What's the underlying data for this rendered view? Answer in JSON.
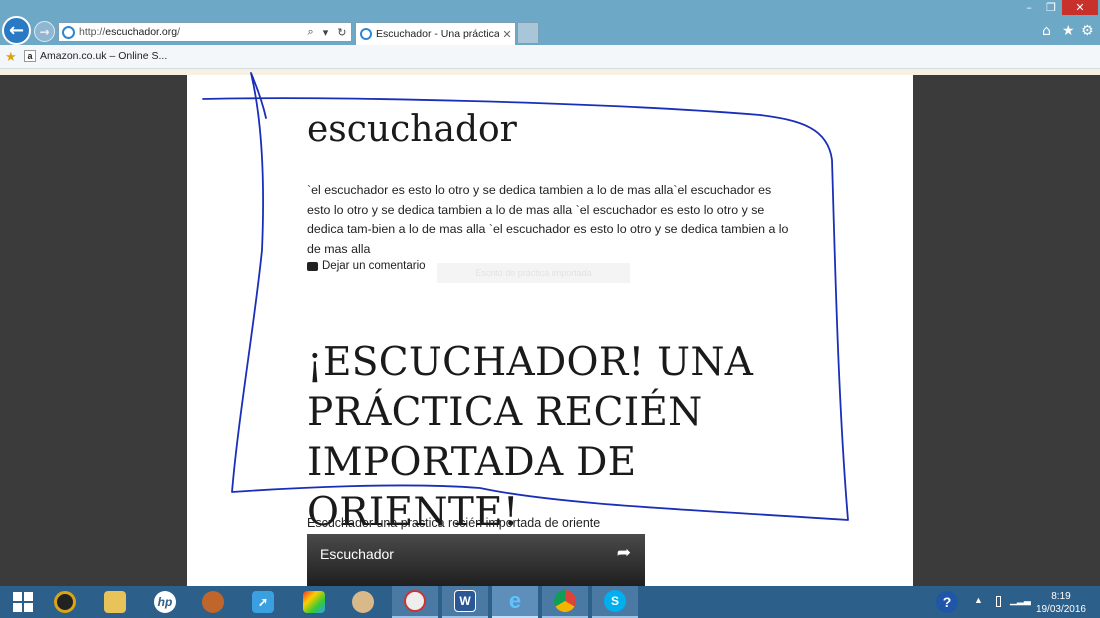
{
  "browser": {
    "url_prefix": "http://",
    "url_domain": "escuchador.org",
    "url_suffix": "/",
    "tab_title": "Escuchador - Una práctica i...",
    "tab_close": "✕",
    "favorites": {
      "item_label": "Amazon.co.uk – Online S..."
    },
    "window": {
      "minimize": "–",
      "maximize": "❐",
      "close": "✕"
    }
  },
  "post": {
    "title": "escuchador",
    "body": "`el escuchador es esto lo otro y se dedica tambien a lo de mas alla`el escuchador es esto lo otro y se dedica tambien a lo de mas alla `el escuchador es esto lo otro y se dedica tam-bien a lo de mas alla `el escuchador es esto lo otro y se dedica tambien a lo de mas alla",
    "comment_link": "Dejar un comentario",
    "faint_link": "Escrito de práctica importada"
  },
  "headline": "¡ESCUCHADOR! UNA PRÁCTICA RECIÉN IMPORTADA DE ORIENTE!",
  "video": {
    "caption": "Escuchador una practica recién importada de oriente",
    "title": "Escuchador"
  },
  "taskbar": {
    "items": [
      {
        "name": "windows-start",
        "icon": "start-icon"
      },
      {
        "name": "media-player",
        "icon": "media-icon"
      },
      {
        "name": "file-explorer",
        "icon": "folder-icon"
      },
      {
        "name": "hp",
        "icon": "hp-icon",
        "label": "hp"
      },
      {
        "name": "baseball-glove",
        "icon": "glove-icon"
      },
      {
        "name": "rocket",
        "icon": "rocket-icon"
      },
      {
        "name": "puzzle",
        "icon": "puzzle-icon"
      },
      {
        "name": "paint",
        "icon": "palette-icon"
      },
      {
        "name": "doodle",
        "icon": "doodle-icon"
      },
      {
        "name": "word",
        "icon": "word-icon",
        "label": "W"
      },
      {
        "name": "internet-explorer",
        "icon": "ie-icon",
        "label": "e"
      },
      {
        "name": "chrome",
        "icon": "chrome-icon"
      },
      {
        "name": "skype",
        "icon": "skype-icon",
        "label": "S"
      }
    ],
    "tray": {
      "help": "?",
      "time": "8:19",
      "date": "19/03/2016"
    }
  },
  "colors": {
    "titlebar": "#6ea8c7",
    "taskbar": "#2c5f8a",
    "pen": "#1a2fb8",
    "close": "#c8302b"
  }
}
